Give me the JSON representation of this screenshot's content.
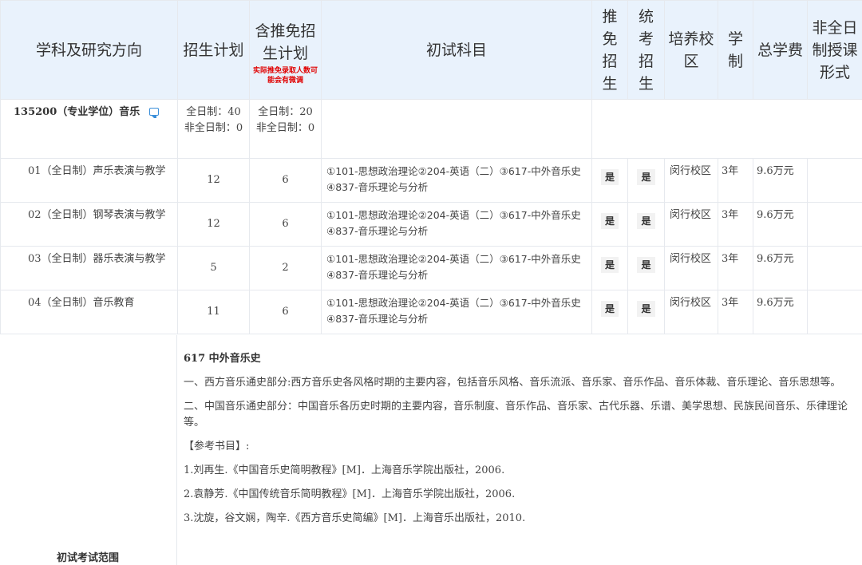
{
  "headers": {
    "col1": "学科及研究方向",
    "col2": "招生计划",
    "col3": "含推免招生计划",
    "col3_note": "实际推免录取人数可能会有微调",
    "col4": "初试科目",
    "col5": "推免招生",
    "col6": "统考招生",
    "col7": "培养校区",
    "col8": "学制",
    "col9": "总学费",
    "col10": "非全日制授课形式"
  },
  "major": {
    "code_name": "135200（专业学位）音乐",
    "plan_full": "全日制：40",
    "plan_part": "非全日制：0",
    "rec_full": "全日制：20",
    "rec_part": "非全日制：0",
    "comment_icon": "comment-icon"
  },
  "rows": [
    {
      "direction": "01（全日制）声乐表演与教学",
      "plan": "12",
      "rec": "6",
      "subjects": "①101-思想政治理论②204-英语（二）③617-中外音乐史④837-音乐理论与分析",
      "tuimian": "是",
      "tongkao": "是",
      "campus": "闵行校区",
      "length": "3年",
      "fee": "9.6万元",
      "mode": ""
    },
    {
      "direction": "02（全日制）钢琴表演与教学",
      "plan": "12",
      "rec": "6",
      "subjects": "①101-思想政治理论②204-英语（二）③617-中外音乐史④837-音乐理论与分析",
      "tuimian": "是",
      "tongkao": "是",
      "campus": "闵行校区",
      "length": "3年",
      "fee": "9.6万元",
      "mode": ""
    },
    {
      "direction": "03（全日制）器乐表演与教学",
      "plan": "5",
      "rec": "2",
      "subjects": "①101-思想政治理论②204-英语（二）③617-中外音乐史④837-音乐理论与分析",
      "tuimian": "是",
      "tongkao": "是",
      "campus": "闵行校区",
      "length": "3年",
      "fee": "9.6万元",
      "mode": ""
    },
    {
      "direction": "04（全日制）音乐教育",
      "plan": "11",
      "rec": "6",
      "subjects": "①101-思想政治理论②204-英语（二）③617-中外音乐史④837-音乐理论与分析",
      "tuimian": "是",
      "tongkao": "是",
      "campus": "闵行校区",
      "length": "3年",
      "fee": "9.6万元",
      "mode": ""
    }
  ],
  "scope": {
    "label": "初试考试范围",
    "title": "617 中外音乐史",
    "para1": "一、西方音乐通史部分:西方音乐史各风格时期的主要内容，包括音乐风格、音乐流派、音乐家、音乐作品、音乐体裁、音乐理论、音乐思想等。",
    "para2": "二、中国音乐通史部分：中国音乐各历史时期的主要内容，音乐制度、音乐作品、音乐家、古代乐器、乐谱、美学思想、民族民间音乐、乐律理论等。",
    "ref_title": "【参考书目】:",
    "refs": [
      "1.刘再生.《中国音乐史简明教程》[M]．上海音乐学院出版社，2006.",
      "2.袁静芳.《中国传统音乐简明教程》[M]．上海音乐学院出版社，2006.",
      "3.沈旋，谷文娴，陶辛.《西方音乐史简编》[M]．上海音乐出版社，2010."
    ]
  }
}
